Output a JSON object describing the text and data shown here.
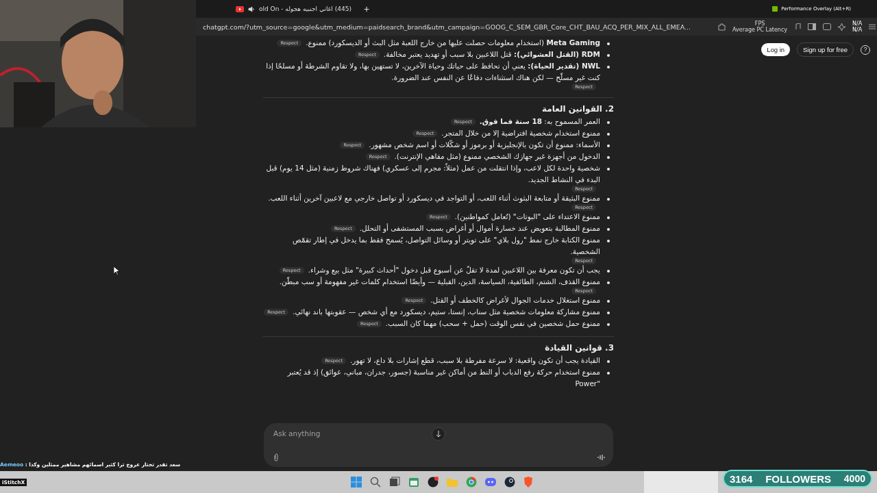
{
  "browser": {
    "tab_title": "(445) اغاني اجنبيه هجوله - old On",
    "new_tab": "+",
    "address": "chatgpt.com/?utm_source=google&utm_medium=paidsearch_brand&utm_campaign=GOOG_C_SEM_GBR_Core_CHT_BAU_ACQ_PER_MIX_ALL_EMEA...",
    "overlay": {
      "title": "Performance Overlay (Alt+R)",
      "fps_label": "FPS",
      "fps_value": "N/A",
      "latency_label": "Average PC Latency",
      "latency_value": "N/A"
    }
  },
  "header": {
    "login": "Log in",
    "signup": "Sign up for free",
    "help": "?"
  },
  "sections": [
    {
      "items": [
        {
          "text": "**Meta Gaming** (استخدام معلومات حصلت عليها من خارج اللعبة مثل البث أو الديسكورد) ممنوع.",
          "tag": "Respect"
        },
        {
          "text": "**RDM (القتل العشوائي):** قتل اللاعبين بلا سبب أو تهديد يعتبر مخالفة.",
          "tag": "Respect"
        },
        {
          "text": "**NWL (تقدير الحياة):** يعني أن تحافظ على حياتك وحياة الآخرين، لا تستهين بها، ولا تقاوم الشرطة أو مسلحًا إذا كنت غير مسلّح — لكن هناك استثناءات دفاعًا عن النفس عند الضرورة.",
          "tag": "Respect"
        }
      ]
    },
    {
      "heading": "2. القوانين العامة",
      "items": [
        {
          "text": "العمر المسموح به: **18 سنة فما فوق.**",
          "tag": "Respect"
        },
        {
          "text": "ممنوع استخدام شخصية افتراضية إلا من خلال المتجر.",
          "tag": "Respect"
        },
        {
          "text": "الأسماء: ممنوع أن تكون بالإنجليزية أو برموز أو شكّلات أو اسم شخص مشهور.",
          "tag": "Respect"
        },
        {
          "text": "الدخول من أجهزة غير جهازك الشخصي ممنوع (مثل مقاهي الإنترنت).",
          "tag": "Respect"
        },
        {
          "text": "شخصية واحدة لكل لاعب، وإذا انتقلت من عمل (مثلاً: مجرم إلى عسكري) فهناك شروط زمنية (مثل 14 يوم) قبل البدء في النشاط الجديد.",
          "tag": "Respect"
        },
        {
          "text": "ممنوع البثيقة أو متابعة البثوث أثناء اللعب، أو التواجد في ديسكورد أو تواصل خارجي مع لاعبين آخرين أثناء اللعب.",
          "tag": "Respect"
        },
        {
          "text": "ممنوع الاعتداء على \"البوتات\" (تُعامل كمواطنين).",
          "tag": "Respect"
        },
        {
          "text": "ممنوع المطالبة بتعويض عند خسارة أموال أو أغراض بسبب المستشفى أو التحلل.",
          "tag": "Respect"
        },
        {
          "text": "ممنوع الكتابة خارج نمط \"رول بلاي\" على تويتر أو وسائل التواصل، يُسمح فقط بما يدخل في إطار تقمّص الشخصية.",
          "tag": "Respect"
        },
        {
          "text": "يجب أن تكون معرفة بين اللاعبين لمدة لا تقلّ عن أسبوع قبل دخول \"أحداث كبيرة\" مثل بيع وشراء.",
          "tag": "Respect"
        },
        {
          "text": "ممنوع القذف، الشتم، الطائفية، السياسة، الدين، القبلية — وأيضًا استخدام كلمات غير مفهومة أو سب مبطّن.",
          "tag": "Respect"
        },
        {
          "text": "ممنوع استغلال خدمات الجوال لأغراض كالخطف أو القتل.",
          "tag": "Respect"
        },
        {
          "text": "ممنوع مشاركة معلومات شخصية مثل سناب، إنستا، ستيم، ديسكورد مع أي شخص — عقوبتها باند نهائي.",
          "tag": "Respect"
        },
        {
          "text": "ممنوع حمل شخصين في نفس الوقت (حمل + سحب) مهما كان السبب.",
          "tag": "Respect"
        }
      ]
    },
    {
      "heading": "3. قوانين القيادة",
      "items": [
        {
          "text": "القيادة يجب أن تكون واقعية: لا سرعة مفرطة بلا سبب، قطع إشارات بلا داع، لا تهور.",
          "tag": "Respect"
        },
        {
          "text": "ممنوع استخدام حركة رفع الدباب أو النط من أماكن غير مناسبة (جسور، جدران، مباني، عوائق) إذ قد يُعتبر \"Power"
        }
      ]
    }
  ],
  "composer": {
    "placeholder": "Ask anything"
  },
  "stream": {
    "chat": [
      {
        "user": "Aemeoo",
        "separator": ":",
        "message": "سعد تقدر تختار عروج ترا كثير اسمائهم مشاهير ممثلين وكذا"
      },
      {
        "user": "iStitchX"
      }
    ],
    "followers": {
      "count": "3164",
      "label": "FOLLOWERS",
      "goal": "4000"
    }
  }
}
